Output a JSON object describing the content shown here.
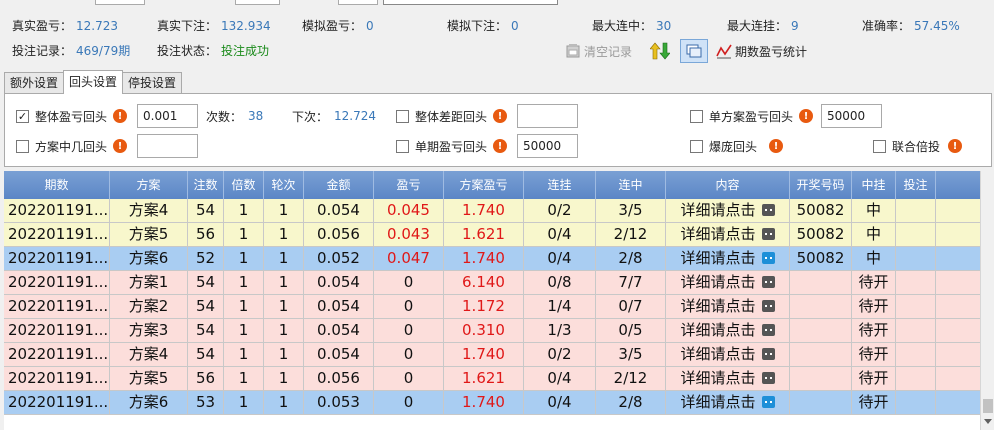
{
  "stats": {
    "real_pl": {
      "label": "真实盈亏：",
      "value": "12.723"
    },
    "real_bet": {
      "label": "真实下注：",
      "value": "132.934"
    },
    "sim_pl": {
      "label": "模拟盈亏：",
      "value": "0"
    },
    "sim_bet": {
      "label": "模拟下注：",
      "value": "0"
    },
    "max_hit": {
      "label": "最大连中：",
      "value": "30"
    },
    "max_miss": {
      "label": "最大连挂：",
      "value": "9"
    },
    "accuracy": {
      "label": "准确率：",
      "value": "57.45%"
    },
    "bet_record": {
      "label": "投注记录：",
      "value": "469/79期"
    },
    "bet_status": {
      "label": "投注状态：",
      "value": "投注成功"
    }
  },
  "toolbar": {
    "clear_label": "清空记录",
    "period_stats_label": "期数盈亏统计"
  },
  "tabs": [
    {
      "label": "额外设置"
    },
    {
      "label": "回头设置"
    },
    {
      "label": "停投设置"
    }
  ],
  "settings": {
    "total_pl_back": {
      "label": "整体盈亏回头",
      "value": "0.001",
      "checked": true
    },
    "count_label": "次数：",
    "count_value": "38",
    "next_label": "下次：",
    "next_value": "12.724",
    "total_gap_back": {
      "label": "整体差距回头",
      "value": ""
    },
    "single_plan_back": {
      "label": "单方案盈亏回头",
      "value": "50000"
    },
    "plan_hit_back": {
      "label": "方案中几回头",
      "value": ""
    },
    "single_period_back": {
      "label": "单期盈亏回头",
      "value": "50000"
    },
    "bust_back": {
      "label": "爆庞回头"
    },
    "joint_multiplier": {
      "label": "联合倍投"
    }
  },
  "table": {
    "columns": [
      "期数",
      "方案",
      "注数",
      "倍数",
      "轮次",
      "金额",
      "盈亏",
      "方案盈亏",
      "连挂",
      "连中",
      "内容",
      "开奖号码",
      "中挂",
      "投注"
    ],
    "rows": [
      {
        "period": "202201191...",
        "plan": "方案4",
        "bets": "54",
        "mult": "1",
        "round": "1",
        "amount": "0.054",
        "pl": "0.045",
        "plan_pl": "1.740",
        "miss": "0/2",
        "hit": "3/5",
        "content": "详细请点击",
        "draw": "50082",
        "result": "中",
        "bet": "",
        "bg": "#f8f7cc"
      },
      {
        "period": "202201191...",
        "plan": "方案5",
        "bets": "56",
        "mult": "1",
        "round": "1",
        "amount": "0.056",
        "pl": "0.043",
        "plan_pl": "1.621",
        "miss": "0/4",
        "hit": "2/12",
        "content": "详细请点击",
        "draw": "50082",
        "result": "中",
        "bet": "",
        "bg": "#f8f7cc"
      },
      {
        "period": "202201191...",
        "plan": "方案6",
        "bets": "52",
        "mult": "1",
        "round": "1",
        "amount": "0.052",
        "pl": "0.047",
        "plan_pl": "1.740",
        "miss": "0/4",
        "hit": "2/8",
        "content": "详细请点击",
        "draw": "50082",
        "result": "中",
        "bet": "",
        "bg": "#a9cdf2"
      },
      {
        "period": "202201191...",
        "plan": "方案1",
        "bets": "54",
        "mult": "1",
        "round": "1",
        "amount": "0.054",
        "pl": "0",
        "plan_pl": "6.140",
        "miss": "0/8",
        "hit": "7/7",
        "content": "详细请点击",
        "draw": "",
        "result": "待开",
        "bet": "",
        "bg": "#fcdedb"
      },
      {
        "period": "202201191...",
        "plan": "方案2",
        "bets": "54",
        "mult": "1",
        "round": "1",
        "amount": "0.054",
        "pl": "0",
        "plan_pl": "1.172",
        "miss": "1/4",
        "hit": "0/7",
        "content": "详细请点击",
        "draw": "",
        "result": "待开",
        "bet": "",
        "bg": "#fcdedb"
      },
      {
        "period": "202201191...",
        "plan": "方案3",
        "bets": "54",
        "mult": "1",
        "round": "1",
        "amount": "0.054",
        "pl": "0",
        "plan_pl": "0.310",
        "miss": "1/3",
        "hit": "0/5",
        "content": "详细请点击",
        "draw": "",
        "result": "待开",
        "bet": "",
        "bg": "#fcdedb"
      },
      {
        "period": "202201191...",
        "plan": "方案4",
        "bets": "54",
        "mult": "1",
        "round": "1",
        "amount": "0.054",
        "pl": "0",
        "plan_pl": "1.740",
        "miss": "0/2",
        "hit": "3/5",
        "content": "详细请点击",
        "draw": "",
        "result": "待开",
        "bet": "",
        "bg": "#fcdedb"
      },
      {
        "period": "202201191...",
        "plan": "方案5",
        "bets": "56",
        "mult": "1",
        "round": "1",
        "amount": "0.056",
        "pl": "0",
        "plan_pl": "1.621",
        "miss": "0/4",
        "hit": "2/12",
        "content": "详细请点击",
        "draw": "",
        "result": "待开",
        "bet": "",
        "bg": "#fcdedb"
      },
      {
        "period": "202201191...",
        "plan": "方案6",
        "bets": "53",
        "mult": "1",
        "round": "1",
        "amount": "0.053",
        "pl": "0",
        "plan_pl": "1.740",
        "miss": "0/4",
        "hit": "2/8",
        "content": "详细请点击",
        "draw": "",
        "result": "待开",
        "bet": "",
        "bg": "#a9cdf2"
      }
    ]
  }
}
